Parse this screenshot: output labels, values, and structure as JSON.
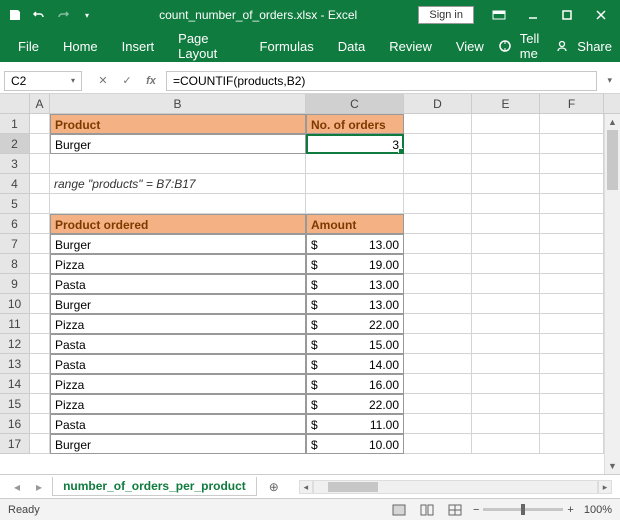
{
  "title": "count_number_of_orders.xlsx - Excel",
  "signin": "Sign in",
  "ribbon": {
    "file": "File",
    "home": "Home",
    "insert": "Insert",
    "pagelayout": "Page Layout",
    "formulas": "Formulas",
    "data": "Data",
    "review": "Review",
    "view": "View",
    "tellme": "Tell me",
    "share": "Share"
  },
  "namebox": "C2",
  "formula": "=COUNTIF(products,B2)",
  "cols": [
    "A",
    "B",
    "C",
    "D",
    "E",
    "F"
  ],
  "rowlabels": [
    "1",
    "2",
    "3",
    "4",
    "5",
    "6",
    "7",
    "8",
    "9",
    "10",
    "11",
    "12",
    "13",
    "14",
    "15",
    "16",
    "17"
  ],
  "sheet": {
    "B1": "Product",
    "C1": "No. of orders",
    "B2": "Burger",
    "C2": "3",
    "B4": "range \"products\" = B7:B17",
    "B6": "Product ordered",
    "C6": "Amount",
    "rows": [
      {
        "b": "Burger",
        "c": "13.00"
      },
      {
        "b": "Pizza",
        "c": "19.00"
      },
      {
        "b": "Pasta",
        "c": "13.00"
      },
      {
        "b": "Burger",
        "c": "13.00"
      },
      {
        "b": "Pizza",
        "c": "22.00"
      },
      {
        "b": "Pasta",
        "c": "15.00"
      },
      {
        "b": "Pasta",
        "c": "14.00"
      },
      {
        "b": "Pizza",
        "c": "16.00"
      },
      {
        "b": "Pizza",
        "c": "22.00"
      },
      {
        "b": "Pasta",
        "c": "11.00"
      },
      {
        "b": "Burger",
        "c": "10.00"
      }
    ],
    "currency": "$"
  },
  "sheettab": "number_of_orders_per_product",
  "status": "Ready",
  "zoom": "100%"
}
